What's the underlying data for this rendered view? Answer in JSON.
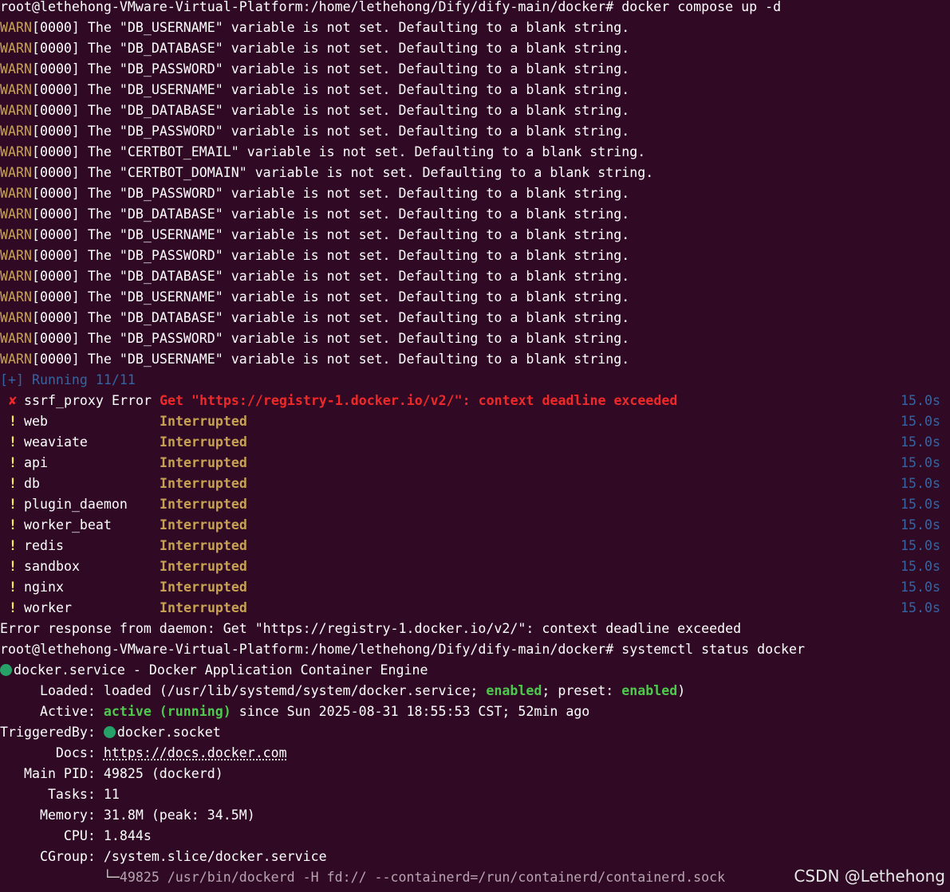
{
  "prompt1": "root@lethehong-VMware-Virtual-Platform:/home/lethehong/Dify/dify-main/docker#",
  "command1": " docker compose up -d",
  "warn_tag": "WARN",
  "warnings": [
    "[0000] The \"DB_USERNAME\" variable is not set. Defaulting to a blank string.",
    "[0000] The \"DB_DATABASE\" variable is not set. Defaulting to a blank string.",
    "[0000] The \"DB_PASSWORD\" variable is not set. Defaulting to a blank string.",
    "[0000] The \"DB_USERNAME\" variable is not set. Defaulting to a blank string.",
    "[0000] The \"DB_DATABASE\" variable is not set. Defaulting to a blank string.",
    "[0000] The \"DB_PASSWORD\" variable is not set. Defaulting to a blank string.",
    "[0000] The \"CERTBOT_EMAIL\" variable is not set. Defaulting to a blank string.",
    "[0000] The \"CERTBOT_DOMAIN\" variable is not set. Defaulting to a blank string.",
    "[0000] The \"DB_PASSWORD\" variable is not set. Defaulting to a blank string.",
    "[0000] The \"DB_DATABASE\" variable is not set. Defaulting to a blank string.",
    "[0000] The \"DB_USERNAME\" variable is not set. Defaulting to a blank string.",
    "[0000] The \"DB_PASSWORD\" variable is not set. Defaulting to a blank string.",
    "[0000] The \"DB_DATABASE\" variable is not set. Defaulting to a blank string.",
    "[0000] The \"DB_USERNAME\" variable is not set. Defaulting to a blank string.",
    "[0000] The \"DB_DATABASE\" variable is not set. Defaulting to a blank string.",
    "[0000] The \"DB_PASSWORD\" variable is not set. Defaulting to a blank string.",
    "[0000] The \"DB_USERNAME\" variable is not set. Defaulting to a blank string."
  ],
  "running_status": "[+] Running 11/11",
  "services": [
    {
      "mark": "✘",
      "name": "ssrf_proxy",
      "tag": "Error",
      "status": "Get \"https://registry-1.docker.io/v2/\": context deadline exceeded",
      "time": "15.0s",
      "kind": "error"
    },
    {
      "mark": "!",
      "name": "web",
      "tag": "",
      "status": "Interrupted",
      "time": "15.0s",
      "kind": "interrupted"
    },
    {
      "mark": "!",
      "name": "weaviate",
      "tag": "",
      "status": "Interrupted",
      "time": "15.0s",
      "kind": "interrupted"
    },
    {
      "mark": "!",
      "name": "api",
      "tag": "",
      "status": "Interrupted",
      "time": "15.0s",
      "kind": "interrupted"
    },
    {
      "mark": "!",
      "name": "db",
      "tag": "",
      "status": "Interrupted",
      "time": "15.0s",
      "kind": "interrupted"
    },
    {
      "mark": "!",
      "name": "plugin_daemon",
      "tag": "",
      "status": "Interrupted",
      "time": "15.0s",
      "kind": "interrupted"
    },
    {
      "mark": "!",
      "name": "worker_beat",
      "tag": "",
      "status": "Interrupted",
      "time": "15.0s",
      "kind": "interrupted"
    },
    {
      "mark": "!",
      "name": "redis",
      "tag": "",
      "status": "Interrupted",
      "time": "15.0s",
      "kind": "interrupted"
    },
    {
      "mark": "!",
      "name": "sandbox",
      "tag": "",
      "status": "Interrupted",
      "time": "15.0s",
      "kind": "interrupted"
    },
    {
      "mark": "!",
      "name": "nginx",
      "tag": "",
      "status": "Interrupted",
      "time": "15.0s",
      "kind": "interrupted"
    },
    {
      "mark": "!",
      "name": "worker",
      "tag": "",
      "status": "Interrupted",
      "time": "15.0s",
      "kind": "interrupted"
    }
  ],
  "daemon_error": "Error response from daemon: Get \"https://registry-1.docker.io/v2/\": context deadline exceeded",
  "prompt2": "root@lethehong-VMware-Virtual-Platform:/home/lethehong/Dify/dify-main/docker#",
  "command2": " systemctl status docker",
  "status": {
    "unit_line": "docker.service - Docker Application Container Engine",
    "loaded_label": "     Loaded: ",
    "loaded_pre": "loaded (/usr/lib/systemd/system/docker.service; ",
    "loaded_enabled": "enabled",
    "loaded_mid": "; preset: ",
    "loaded_preset": "enabled",
    "loaded_post": ")",
    "active_label": "     Active: ",
    "active_state": "active (running)",
    "active_since": " since Sun 2025-08-31 18:55:53 CST; 52min ago",
    "triggered_label": "TriggeredBy: ",
    "triggered_value": "docker.socket",
    "docs_label": "       Docs: ",
    "docs_value": "https://docs.docker.com",
    "pid_label": "   Main PID: ",
    "pid_value": "49825 (dockerd)",
    "tasks_label": "      Tasks: ",
    "tasks_value": "11",
    "memory_label": "     Memory: ",
    "memory_value": "31.8M (peak: 34.5M)",
    "cpu_label": "        CPU: ",
    "cpu_value": "1.844s",
    "cgroup_label": "     CGroup: ",
    "cgroup_value": "/system.slice/docker.service",
    "tree_glyph": "             └─",
    "tree_value": "49825 /usr/bin/dockerd -H fd:// --containerd=/run/containerd/containerd.sock"
  },
  "watermark": "CSDN @Lethehong",
  "colors": {
    "background": "#300a24",
    "warn": "#c7a252",
    "error": "#ef2929",
    "running": "#3465a4",
    "active_green": "#4ec94e",
    "status_dot": "#26a269"
  }
}
